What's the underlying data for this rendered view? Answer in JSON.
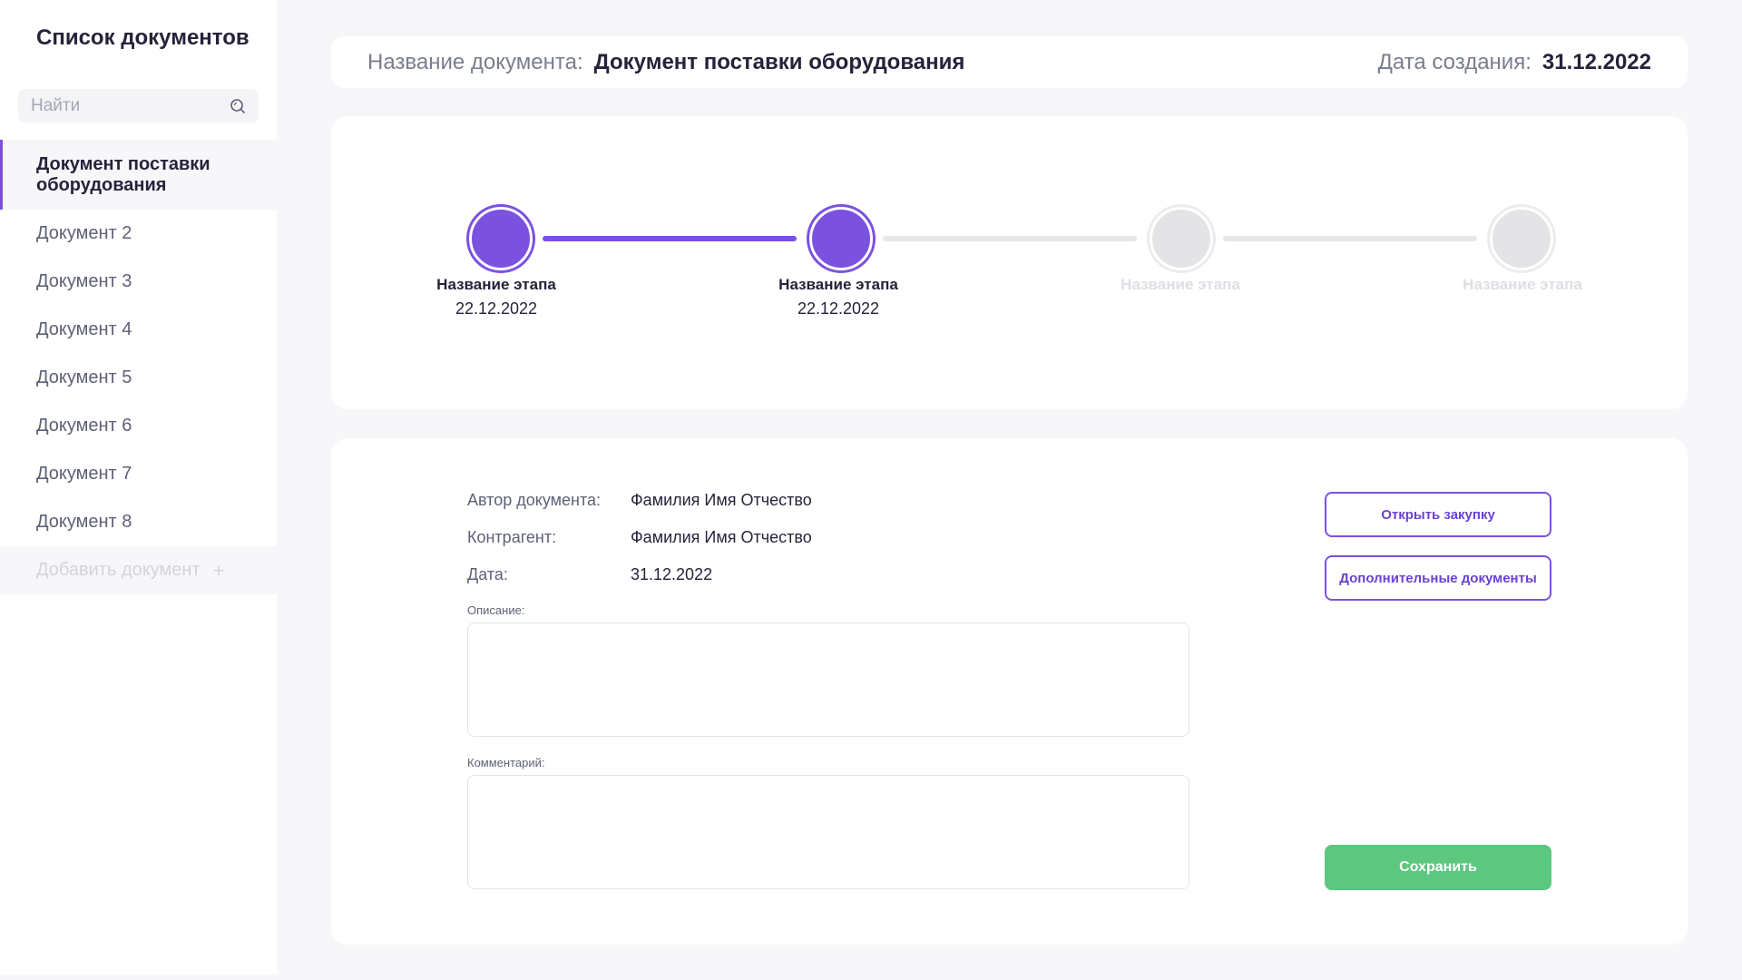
{
  "sidebar": {
    "title": "Список документов",
    "search_placeholder": "Найти",
    "items": [
      {
        "label": "Документ поставки оборудования",
        "active": true
      },
      {
        "label": "Документ 2"
      },
      {
        "label": "Документ 3"
      },
      {
        "label": "Документ 4"
      },
      {
        "label": "Документ 5"
      },
      {
        "label": "Документ 6"
      },
      {
        "label": "Документ 7"
      },
      {
        "label": "Документ 8"
      }
    ],
    "add_label": "Добавить документ",
    "icons": {
      "search": "search-icon",
      "add": "plus-icon"
    }
  },
  "header": {
    "name_label": "Название документа:",
    "name_value": "Документ поставки оборудования",
    "date_label": "Дата создания:",
    "date_value": "31.12.2022"
  },
  "stepper": {
    "steps": [
      {
        "label": "Название этапа",
        "date": "22.12.2022",
        "status": "done"
      },
      {
        "label": "Название этапа",
        "date": "22.12.2022",
        "status": "done"
      },
      {
        "label": "Название этапа",
        "date": "",
        "status": "pending"
      },
      {
        "label": "Название этапа",
        "date": "",
        "status": "pending"
      }
    ]
  },
  "details": {
    "author_label": "Автор документа:",
    "author_value": "Фамилия Имя Отчество",
    "counterparty_label": "Контрагент:",
    "counterparty_value": "Фамилия Имя Отчество",
    "date_label": "Дата:",
    "date_value": "31.12.2022",
    "description_label": "Описание:",
    "description_value": "",
    "comment_label": "Комментарий:",
    "comment_value": ""
  },
  "actions": {
    "open_purchase": "Открыть закупку",
    "additional_docs": "Дополнительные документы",
    "save": "Сохранить"
  },
  "colors": {
    "accent": "#7b51e0",
    "save": "#5bc77f",
    "pending": "#e4e4e6",
    "background": "#f7f7f9"
  }
}
